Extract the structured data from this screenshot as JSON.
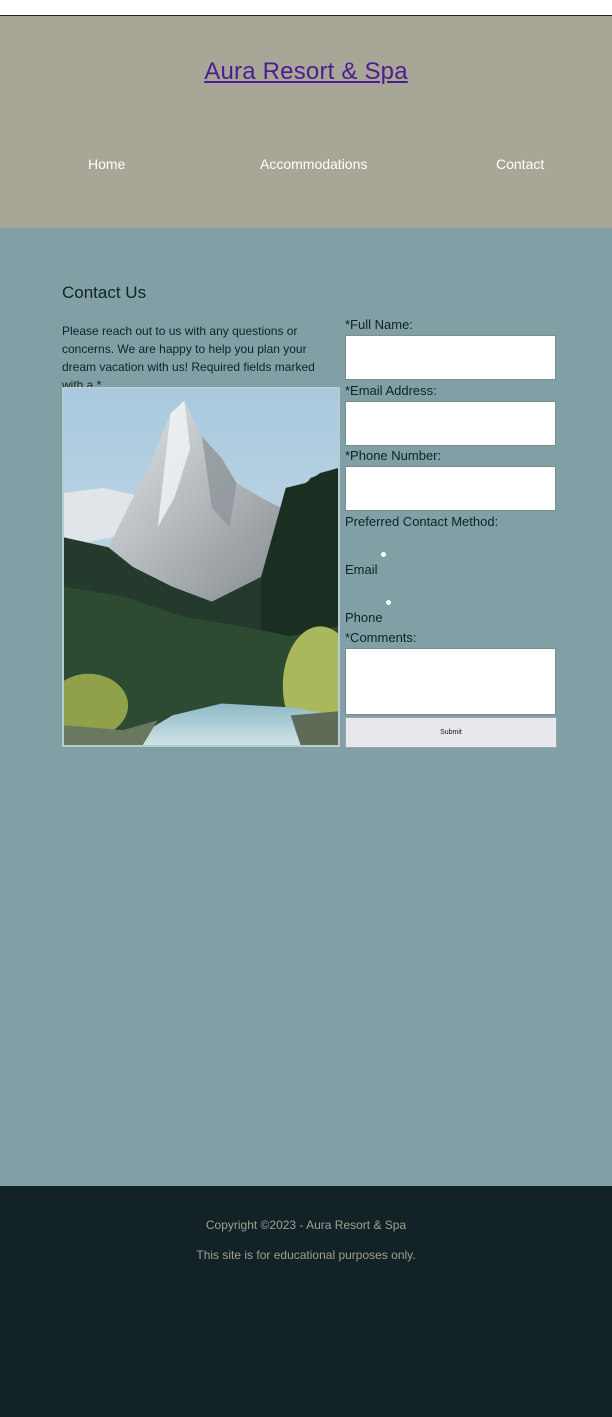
{
  "header": {
    "title": "Aura Resort & Spa",
    "nav": [
      "Home",
      "Accommodations",
      "Contact"
    ]
  },
  "main": {
    "heading": "Contact Us",
    "intro": "Please reach out to us with any questions or concerns. We are happy to help you plan your dream vacation with us! Required fields marked with a *",
    "form": {
      "full_name_label": "*Full Name:",
      "email_label": "*Email Address:",
      "phone_label": "*Phone Number:",
      "method_label": "Preferred Contact Method:",
      "method_options": [
        "Email",
        "Phone"
      ],
      "comments_label": "*Comments:",
      "submit_label": "Submit"
    }
  },
  "footer": {
    "copyright": "Copyright ©2023 - Aura Resort & Spa",
    "disclaimer": "This site is for educational purposes only."
  },
  "colors": {
    "header_bg": "#a8a797",
    "main_bg": "#80a0a5",
    "footer_bg": "#122226",
    "title_link": "#4b1d8f"
  }
}
